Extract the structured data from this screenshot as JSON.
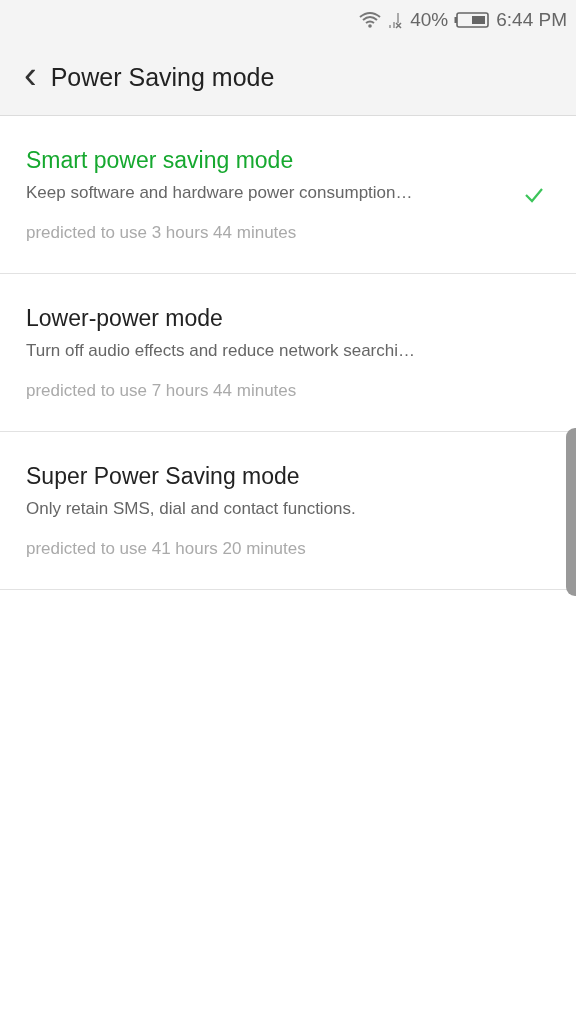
{
  "status_bar": {
    "battery": "40%",
    "time": "6:44 PM"
  },
  "header": {
    "back": "‹",
    "title": "Power Saving mode"
  },
  "modes": [
    {
      "title": "Smart power saving mode",
      "description": "Keep software and hardware power consumption…",
      "prediction": "predicted to use 3 hours 44 minutes",
      "selected": true
    },
    {
      "title": "Lower-power mode",
      "description": "Turn off audio effects and reduce network searchi…",
      "prediction": "predicted to use 7 hours 44 minutes",
      "selected": false
    },
    {
      "title": "Super Power Saving mode",
      "description": "Only retain SMS, dial and contact functions.",
      "prediction": "predicted to use 41 hours 20 minutes",
      "selected": false
    }
  ]
}
